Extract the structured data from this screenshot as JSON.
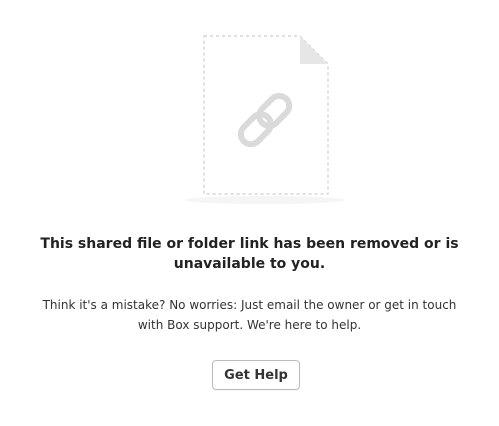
{
  "error": {
    "heading_line1": "This shared file or folder link has been removed or is",
    "heading_line2": "unavailable to you.",
    "message_line1": "Think it's a mistake? No worries: Just email the owner or get in touch",
    "message_line2": "with Box support. We're here to help.",
    "button_label": "Get Help"
  },
  "illustration": {
    "icon": "broken-link-file-icon",
    "stroke_color": "#d8d8d8",
    "fold_color": "#e3e3e3"
  }
}
